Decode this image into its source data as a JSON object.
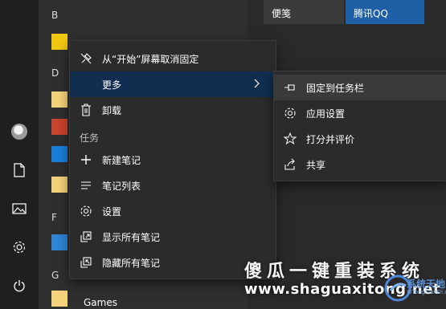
{
  "rail": {
    "icons": [
      "avatar",
      "document-icon",
      "pictures-icon",
      "settings-icon",
      "power-icon"
    ]
  },
  "app_list": {
    "letters": {
      "b": "B",
      "d": "D",
      "f": "F",
      "g": "G"
    },
    "games_label": "Games"
  },
  "tiles": [
    {
      "label": "便笺",
      "color": "#3b3b3b"
    },
    {
      "label": "腾讯QQ",
      "color": "#1f5fa5"
    }
  ],
  "context_menu": {
    "items": {
      "unpin": "从“开始”屏幕取消固定",
      "more": "更多",
      "uninstall": "卸载",
      "tasks_header": "任务",
      "new_note": "新建笔记",
      "note_list": "笔记列表",
      "settings": "设置",
      "show_all": "显示所有笔记",
      "hide_all": "隐藏所有笔记"
    }
  },
  "submenu": {
    "items": {
      "pin_taskbar": "固定到任务栏",
      "app_settings": "应用设置",
      "rate_review": "打分并评价",
      "share": "共享"
    }
  },
  "watermark": {
    "title": "傻瓜一键重装系统",
    "url": "www.shaguaxitong.net",
    "logo_text": "系统天地",
    "logo_sub": "XiTongTianDi.net"
  },
  "colors": {
    "highlight": "#112d4f",
    "qq_tile": "#1f5fa5",
    "accent_blue": "#0078d7"
  }
}
